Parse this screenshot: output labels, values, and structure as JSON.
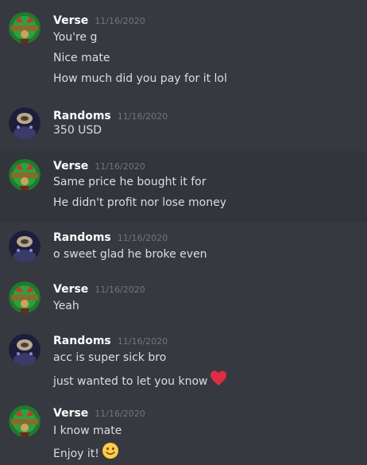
{
  "users": {
    "verse": {
      "name": "Verse",
      "avatar_icon": "verse-avatar-icon"
    },
    "randoms": {
      "name": "Randoms",
      "avatar_icon": "randoms-avatar-icon"
    }
  },
  "colors": {
    "background": "#36393f",
    "hover_background": "#32353b",
    "username": "#ffffff",
    "timestamp": "#72767d",
    "message_text": "#dcddde",
    "heart": "#dd2e44",
    "smiley": "#ffcc4d"
  },
  "groups": [
    {
      "author": "Verse",
      "timestamp": "11/16/2020",
      "messages": [
        "You're g",
        "Nice mate",
        "How much did you pay for it lol"
      ]
    },
    {
      "author": "Randoms",
      "timestamp": "11/16/2020",
      "messages": [
        "350 USD"
      ]
    },
    {
      "author": "Verse",
      "timestamp": "11/16/2020",
      "messages": [
        "Same price he bought it for",
        "He didn't profit nor lose money"
      ]
    },
    {
      "author": "Randoms",
      "timestamp": "11/16/2020",
      "messages": [
        "o sweet glad he broke even"
      ]
    },
    {
      "author": "Verse",
      "timestamp": "11/16/2020",
      "messages": [
        "Yeah"
      ]
    },
    {
      "author": "Randoms",
      "timestamp": "11/16/2020",
      "messages": [
        "acc is super sick bro",
        "just wanted to let you know"
      ],
      "emoji_last": "heart-emoji"
    },
    {
      "author": "Verse",
      "timestamp": "11/16/2020",
      "messages": [
        "I know mate",
        "Enjoy it!"
      ],
      "emoji_last": "slightly-smiling-face-emoji"
    }
  ]
}
